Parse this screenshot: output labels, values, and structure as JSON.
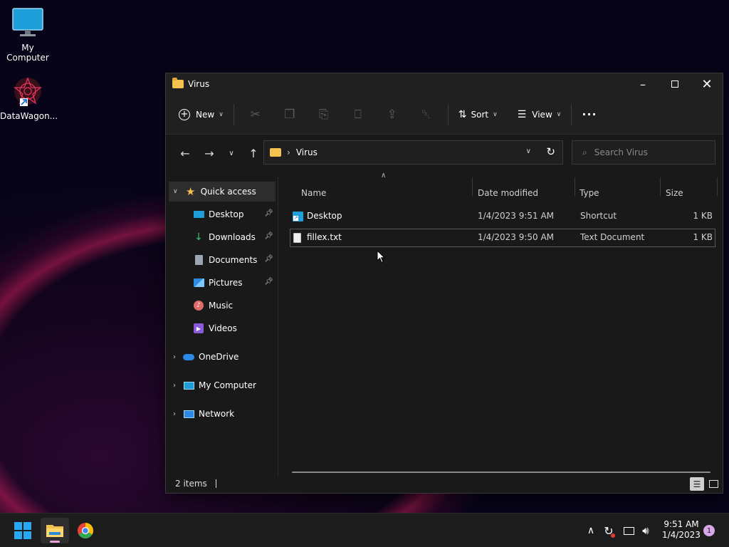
{
  "desktop": {
    "icons": [
      {
        "label": "My Computer"
      },
      {
        "label": "DataWagon..."
      }
    ]
  },
  "window": {
    "title": "Virus",
    "toolbar": {
      "new_label": "New",
      "sort_label": "Sort",
      "view_label": "View",
      "more_label": "···"
    },
    "address": {
      "separator": "›",
      "path": "Virus"
    },
    "search": {
      "placeholder": "Search Virus"
    },
    "nav": {
      "quick_access": "Quick access",
      "items": [
        {
          "label": "Desktop",
          "pinned": true
        },
        {
          "label": "Downloads",
          "pinned": true
        },
        {
          "label": "Documents",
          "pinned": true
        },
        {
          "label": "Pictures",
          "pinned": true
        },
        {
          "label": "Music",
          "pinned": false
        },
        {
          "label": "Videos",
          "pinned": false
        }
      ],
      "onedrive": "OneDrive",
      "my_computer": "My Computer",
      "network": "Network"
    },
    "columns": {
      "name": "Name",
      "date": "Date modified",
      "type": "Type",
      "size": "Size"
    },
    "files": [
      {
        "name": "Desktop",
        "date": "1/4/2023 9:51 AM",
        "type": "Shortcut",
        "size": "1 KB"
      },
      {
        "name": "fillex.txt",
        "date": "1/4/2023 9:50 AM",
        "type": "Text Document",
        "size": "1 KB"
      }
    ],
    "status": "2 items"
  },
  "taskbar": {
    "time": "9:51 AM",
    "date": "1/4/2023",
    "notification_count": "1"
  },
  "colors": {
    "accent": "#4cc2ff",
    "folder": "#f2c14e",
    "window_bg": "#191919",
    "taskbar_bg": "#1c1c1c"
  }
}
